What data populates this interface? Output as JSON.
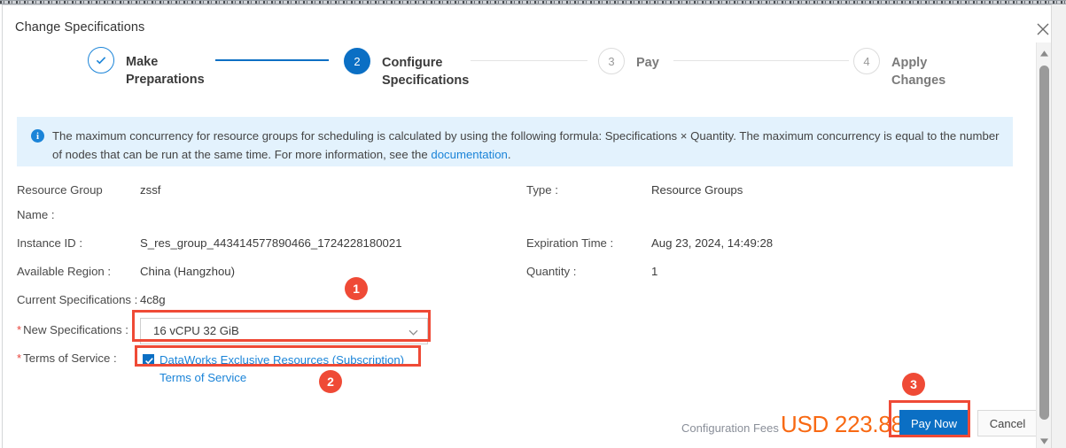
{
  "dialog": {
    "title": "Change Specifications",
    "close_icon": "close-icon"
  },
  "stepper": {
    "steps": [
      {
        "num": "✓",
        "label": "Make Preparations",
        "state": "done"
      },
      {
        "num": "2",
        "label": "Configure Specifications",
        "state": "active"
      },
      {
        "num": "3",
        "label": "Pay",
        "state": "todo"
      },
      {
        "num": "4",
        "label": "Apply Changes",
        "state": "todo"
      }
    ]
  },
  "banner": {
    "icon": "info-icon",
    "text_before_link": "The maximum concurrency for resource groups for scheduling is calculated by using the following formula: Specifications × Quantity. The maximum concurrency is equal to the number of nodes that can be run at the same time. For more information, see the ",
    "link_text": "documentation",
    "text_after_link": "."
  },
  "form": {
    "left": [
      {
        "label": "Resource Group Name :",
        "value": "zssf"
      },
      {
        "label": "Instance ID :",
        "value": "S_res_group_443414577890466_1724228180021"
      },
      {
        "label": "Available Region :",
        "value": "China (Hangzhou)"
      },
      {
        "label": "Current Specifications :",
        "value": "4c8g"
      }
    ],
    "right": [
      {
        "label": "Type :",
        "value": "Resource Groups"
      },
      {
        "label": "Expiration Time :",
        "value": "Aug 23, 2024, 14:49:28"
      },
      {
        "label": "Quantity :",
        "value": "1"
      }
    ],
    "new_spec": {
      "label": "New Specifications :",
      "required_marker": "*",
      "selected": "16 vCPU 32 GiB",
      "caret_icon": "chevron-down-icon"
    },
    "terms": {
      "label": "Terms of Service :",
      "required_marker": "*",
      "checked": true,
      "check_icon": "checkmark-icon",
      "text": "DataWorks Exclusive Resources (Subscription) Terms of Service"
    }
  },
  "footer": {
    "fee_label": "Configuration Fees",
    "price": "USD 223.88",
    "pay_label": "Pay Now",
    "cancel_label": "Cancel"
  },
  "annotations": {
    "badges": [
      {
        "num": "1"
      },
      {
        "num": "2"
      },
      {
        "num": "3"
      }
    ],
    "highlight_color": "#ef4a36"
  },
  "scrollbar": {
    "up_icon": "scroll-up-arrow-icon",
    "down_icon": "scroll-down-arrow-icon",
    "thumb": "scrollbar-thumb"
  },
  "colors": {
    "accent_blue": "#0b6fc4",
    "banner_bg": "#e3f2fd",
    "price_orange": "#f86913",
    "marker_red": "#ef4a36"
  }
}
